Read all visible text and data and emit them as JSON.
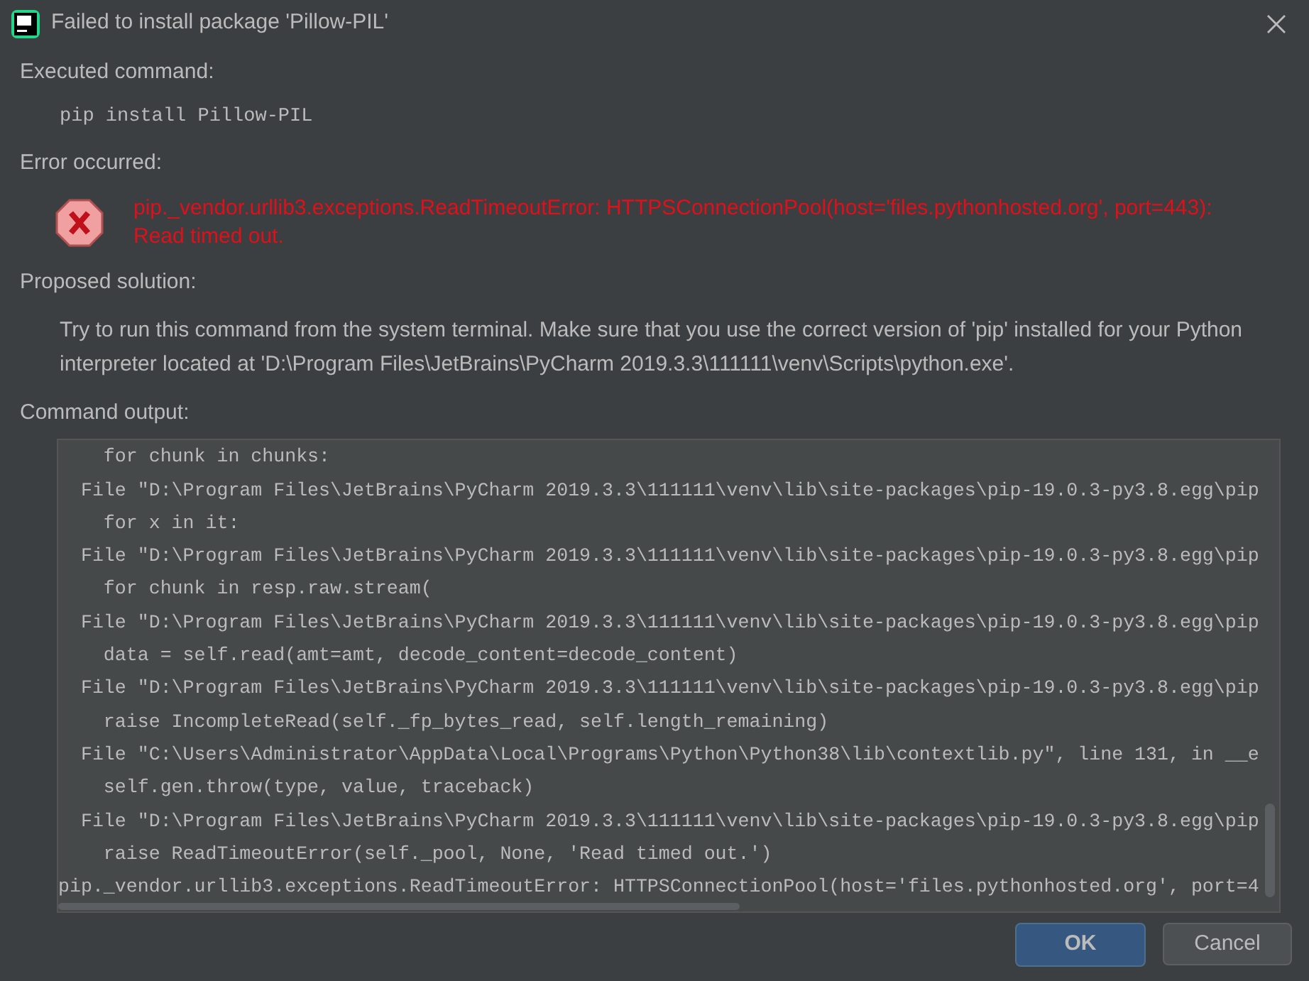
{
  "window": {
    "title": "Failed to install package 'Pillow-PIL'"
  },
  "sections": [
    {
      "kind": "command",
      "label": "Executed command:",
      "text": "pip install Pillow-PIL"
    },
    {
      "kind": "error",
      "label": "Error occurred:",
      "text": "pip._vendor.urllib3.exceptions.ReadTimeoutError: HTTPSConnectionPool(host='files.pythonhosted.org', port=443): Read timed out."
    },
    {
      "kind": "text",
      "label": "Proposed solution:",
      "text": "Try to run this command from the system terminal. Make sure that you use the correct version of 'pip' installed for your Python interpreter located at 'D:\\Program Files\\JetBrains\\PyCharm 2019.3.3\\111111\\venv\\Scripts\\python.exe'."
    },
    {
      "kind": "output",
      "label": "Command output:",
      "lines": [
        "    for chunk in chunks:",
        "  File \"D:\\Program Files\\JetBrains\\PyCharm 2019.3.3\\111111\\venv\\lib\\site-packages\\pip-19.0.3-py3.8.egg\\pip",
        "    for x in it:",
        "  File \"D:\\Program Files\\JetBrains\\PyCharm 2019.3.3\\111111\\venv\\lib\\site-packages\\pip-19.0.3-py3.8.egg\\pip",
        "    for chunk in resp.raw.stream(",
        "  File \"D:\\Program Files\\JetBrains\\PyCharm 2019.3.3\\111111\\venv\\lib\\site-packages\\pip-19.0.3-py3.8.egg\\pip",
        "    data = self.read(amt=amt, decode_content=decode_content)",
        "  File \"D:\\Program Files\\JetBrains\\PyCharm 2019.3.3\\111111\\venv\\lib\\site-packages\\pip-19.0.3-py3.8.egg\\pip",
        "    raise IncompleteRead(self._fp_bytes_read, self.length_remaining)",
        "  File \"C:\\Users\\Administrator\\AppData\\Local\\Programs\\Python\\Python38\\lib\\contextlib.py\", line 131, in __e",
        "    self.gen.throw(type, value, traceback)",
        "  File \"D:\\Program Files\\JetBrains\\PyCharm 2019.3.3\\111111\\venv\\lib\\site-packages\\pip-19.0.3-py3.8.egg\\pip",
        "    raise ReadTimeoutError(self._pool, None, 'Read timed out.')",
        "pip._vendor.urllib3.exceptions.ReadTimeoutError: HTTPSConnectionPool(host='files.pythonhosted.org', port=4"
      ]
    }
  ],
  "buttons": [
    {
      "label": "OK",
      "default": true
    },
    {
      "label": "Cancel",
      "default": false
    }
  ]
}
